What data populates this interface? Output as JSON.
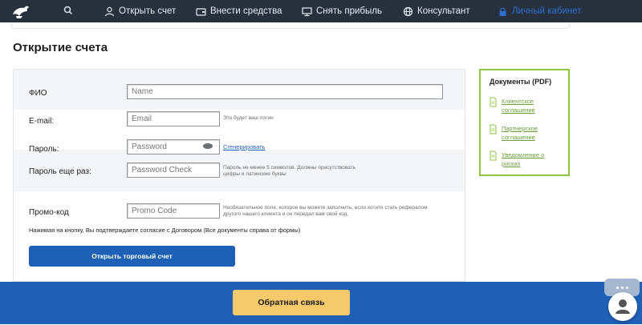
{
  "nav": {
    "items": [
      {
        "label": "Открыть счет",
        "icon": "user-icon"
      },
      {
        "label": "Внести средства",
        "icon": "wallet-icon"
      },
      {
        "label": "Снять прибыль",
        "icon": "monitor-icon"
      },
      {
        "label": "Консультант",
        "icon": "globe-icon"
      },
      {
        "label": "Личный кабинет",
        "icon": "lock-icon"
      }
    ],
    "search_icon": "search-icon",
    "logo_icon": "logo-icon"
  },
  "page": {
    "title": "Открытие счета"
  },
  "form": {
    "fio": {
      "label": "ФИО",
      "placeholder": "Name"
    },
    "email": {
      "label": "E-mail:",
      "placeholder": "Email",
      "hint": "Это будет ваш логин"
    },
    "password": {
      "label": "Пароль:",
      "placeholder": "Password",
      "generate_link": "Сгенерировать",
      "hint": "Пароль не менее 5 символов. Должны присутствовать цифры и латинские буквы"
    },
    "password_check": {
      "label": "Пароль еще раз:",
      "placeholder": "Password Check"
    },
    "promo": {
      "label": "Промо-код",
      "placeholder": "Promo Code",
      "hint": "Необязательное поле, которое вы можете заполнить, если хотите стать рефералом другого нашего клиента и он передал вам свой код."
    },
    "agree_text": "Нажимая на кнопку, Вы подтверждаете согласие с Договором (Все документы справа от формы)",
    "submit_label": "Открыть торговый счет"
  },
  "docs": {
    "title": "Документы (PDF)",
    "items": [
      {
        "label": "Клиентское соглашение"
      },
      {
        "label": "Партнерское соглашение"
      },
      {
        "label": "Уведомление о рисках"
      }
    ]
  },
  "footer": {
    "feedback_label": "Обратная связь"
  },
  "colors": {
    "nav_bg": "#26313d",
    "primary": "#1d60b5",
    "footer": "#1f5fb5",
    "docs_border": "#8dc63f",
    "feedback": "#f6c96a"
  }
}
